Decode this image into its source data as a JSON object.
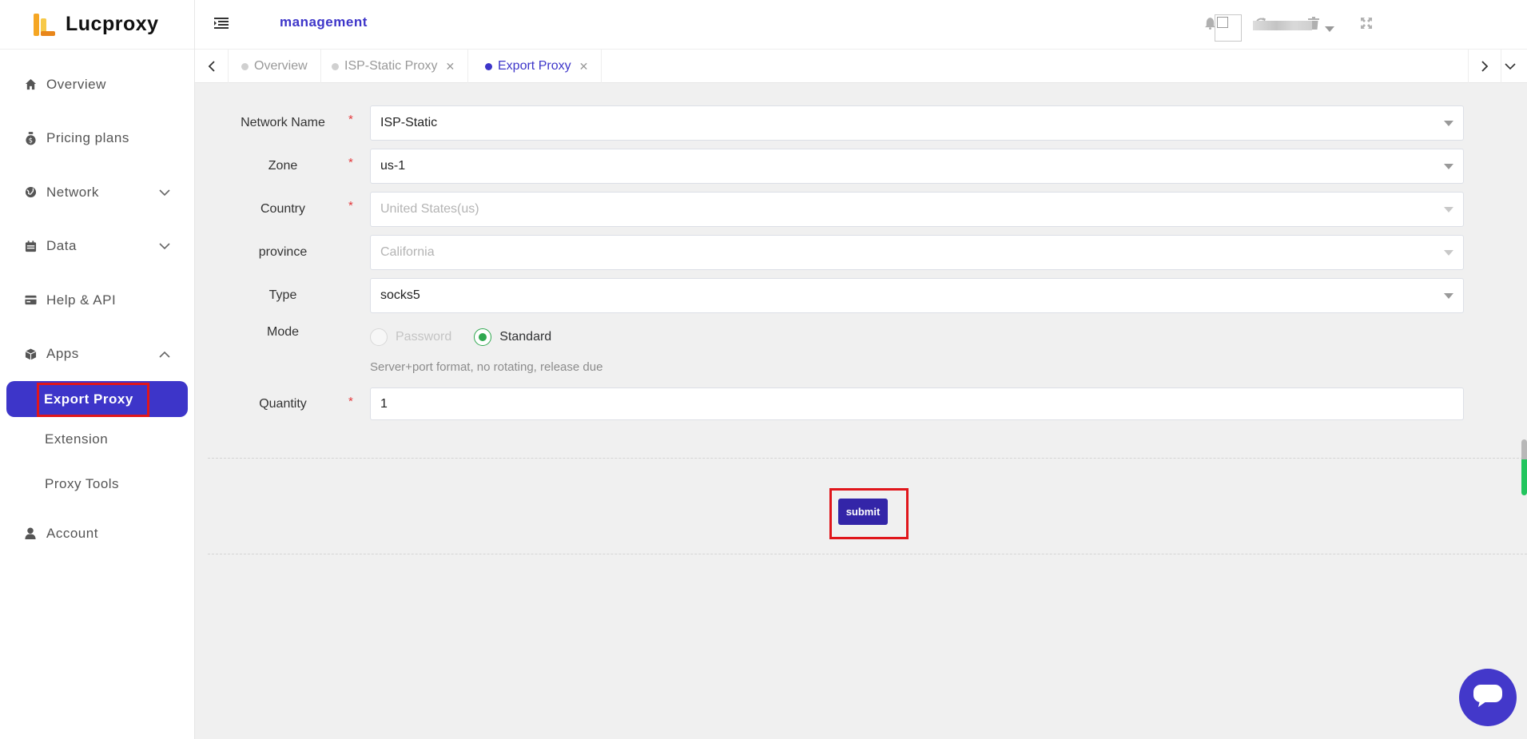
{
  "brand": {
    "name": "Lucproxy"
  },
  "sidebar": {
    "items": [
      {
        "label": "Overview",
        "icon": "home-icon"
      },
      {
        "label": "Pricing plans",
        "icon": "money-bag-icon"
      },
      {
        "label": "Network",
        "icon": "globe-icon",
        "expand": "chevron-down-icon"
      },
      {
        "label": "Data",
        "icon": "calendar-icon",
        "expand": "chevron-down-icon"
      },
      {
        "label": "Help & API",
        "icon": "card-icon"
      },
      {
        "label": "Apps",
        "icon": "cube-icon",
        "expand": "chevron-up-icon"
      }
    ],
    "apps_children": [
      {
        "label": "Export Proxy",
        "active": true
      },
      {
        "label": "Extension"
      },
      {
        "label": "Proxy Tools"
      }
    ],
    "account": {
      "label": "Account",
      "icon": "user-icon"
    },
    "active_color": "#3d35c9"
  },
  "header": {
    "title": "management",
    "icons": [
      "bell-icon",
      "refresh-icon",
      "trash-icon",
      "fullscreen-icon"
    ]
  },
  "tabs": [
    {
      "label": "Overview",
      "closable": false,
      "active": false
    },
    {
      "label": "ISP-Static Proxy",
      "closable": true,
      "active": false
    },
    {
      "label": "Export Proxy",
      "closable": true,
      "active": true
    }
  ],
  "form": {
    "network_name": {
      "label": "Network Name",
      "value": "ISP-Static",
      "required": true
    },
    "zone": {
      "label": "Zone",
      "value": "us-1",
      "required": true
    },
    "country": {
      "label": "Country",
      "value": "United States(us)",
      "required": true,
      "disabled": true
    },
    "province": {
      "label": "province",
      "value": "California",
      "disabled": true
    },
    "type": {
      "label": "Type",
      "value": "socks5"
    },
    "mode": {
      "label": "Mode",
      "options": [
        {
          "label": "Password",
          "checked": false,
          "disabled": true
        },
        {
          "label": "Standard",
          "checked": true,
          "disabled": false
        }
      ],
      "hint": "Server+port format, no rotating, release due"
    },
    "quantity": {
      "label": "Quantity",
      "value": "1",
      "required": true
    },
    "required_mark": "*",
    "submit_label": "submit"
  },
  "colors": {
    "primary": "#3325a8",
    "accent": "#3d35c9",
    "success": "#2fa84f",
    "highlight": "#e0161b"
  }
}
